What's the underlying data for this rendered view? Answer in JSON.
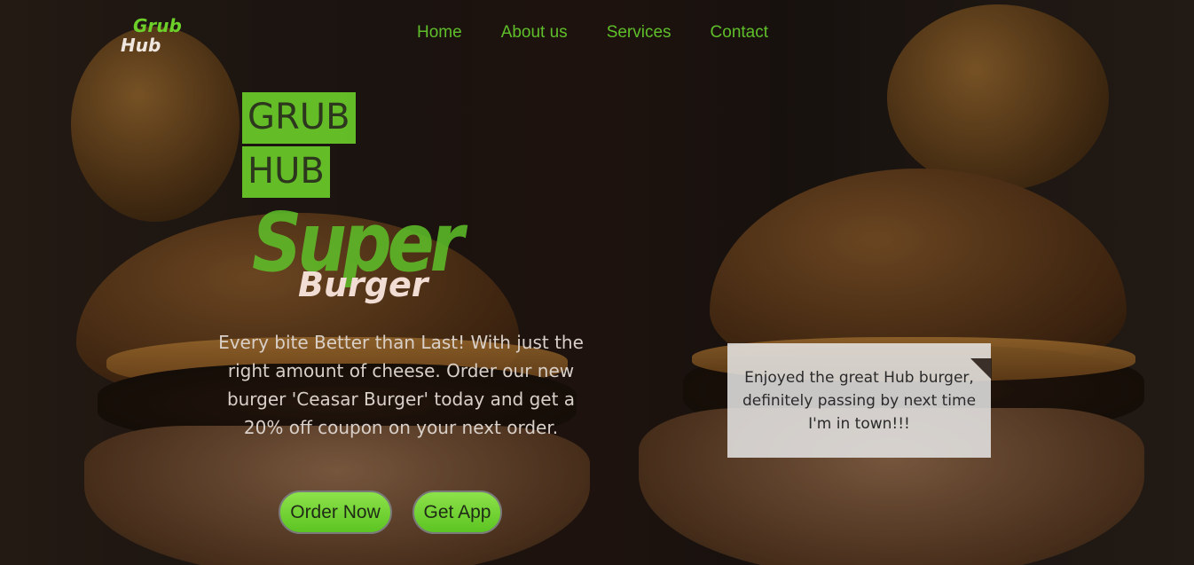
{
  "nav": {
    "logo_line1": "Grub",
    "logo_line2": "Hub",
    "links": [
      "Home",
      "About us",
      "Services",
      "Contact"
    ]
  },
  "hero": {
    "tag_line1": "GRUB",
    "tag_line2": "HUB",
    "title_big": "Super",
    "title_small": "Burger",
    "description": "Every bite Better than Last! With just the right amount of cheese. Order our new burger 'Ceasar Burger' today and get a 20% off coupon on your next order.",
    "buttons": {
      "order": "Order Now",
      "app": "Get App"
    }
  },
  "testimonial": {
    "text": "Enjoyed the great Hub burger, definitely passing by next time I'm in town!!!"
  },
  "colors": {
    "accent_green": "#6ccf2a",
    "nav_green": "#5fbf2a",
    "light_text": "#f1ddd3"
  }
}
